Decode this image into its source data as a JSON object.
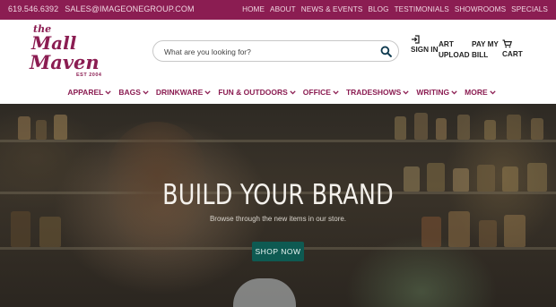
{
  "topbar": {
    "phone": "619.546.6392",
    "email": "SALES@IMAGEONEGROUP.COM",
    "links": [
      "HOME",
      "ABOUT",
      "NEWS & EVENTS",
      "BLOG",
      "TESTIMONIALS",
      "SHOWROOMS",
      "SPECIALS"
    ]
  },
  "logo": {
    "line1": "the",
    "line2": "Mall",
    "line3": "Maven",
    "est": "EST 2004"
  },
  "search": {
    "placeholder": "What are you looking for?",
    "icon": "search-icon"
  },
  "header_links": {
    "sign_in": "SIGN IN",
    "art_upload": "ART UPLOAD",
    "pay_bill": "PAY MY BILL",
    "cart": "CART"
  },
  "nav": {
    "items": [
      "APPAREL",
      "BAGS",
      "DRINKWARE",
      "FUN & OUTDOORS",
      "OFFICE",
      "TRADESHOWS",
      "WRITING",
      "MORE"
    ]
  },
  "hero": {
    "title": "BUILD YOUR BRAND",
    "subtitle": "Browse through the new items in our store.",
    "button": "SHOP NOW"
  },
  "colors": {
    "brand": "#8b1d52",
    "button": "#0e5a52"
  }
}
